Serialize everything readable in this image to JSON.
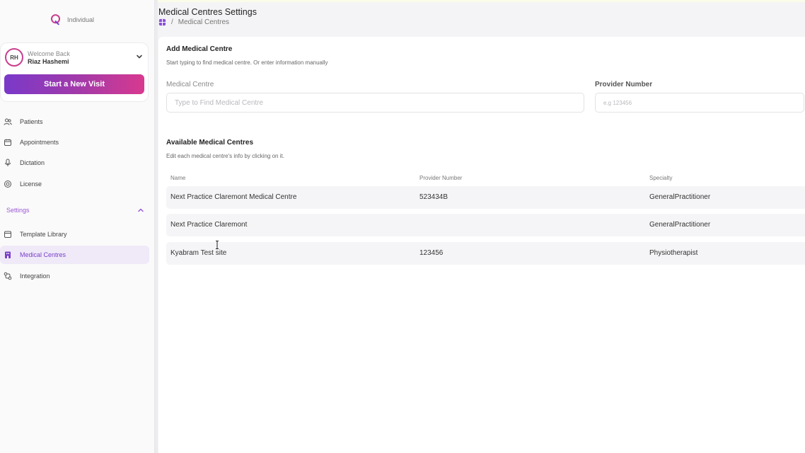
{
  "brand": {
    "name": "Individual",
    "accent": "#c93f8f"
  },
  "user": {
    "initials": "RH",
    "welcome": "Welcome Back",
    "name": "Riaz Hashemi"
  },
  "start_visit_label": "Start a New Visit",
  "nav": {
    "items": [
      {
        "label": "Patients",
        "icon": "users-icon"
      },
      {
        "label": "Appointments",
        "icon": "calendar-icon"
      },
      {
        "label": "Dictation",
        "icon": "microphone-icon"
      },
      {
        "label": "License",
        "icon": "license-icon"
      }
    ],
    "settings_label": "Settings",
    "settings_items": [
      {
        "label": "Template Library",
        "icon": "template-icon"
      },
      {
        "label": "Medical Centres",
        "icon": "building-icon",
        "active": true
      },
      {
        "label": "Integration",
        "icon": "integration-icon"
      }
    ]
  },
  "header": {
    "title": "Medical Centres Settings",
    "breadcrumb_sep": "/",
    "breadcrumb_current": "Medical Centres"
  },
  "add_section": {
    "title": "Add Medical Centre",
    "subtitle": "Start typing to find medical centre. Or enter information manually",
    "centre_label": "Medical Centre",
    "centre_placeholder": "Type to Find Medical Centre",
    "provider_label": "Provider Number",
    "provider_placeholder": "e.g 123456"
  },
  "available_section": {
    "title": "Available Medical Centres",
    "subtitle": "Edit each medical centre's info by clicking on it.",
    "columns": [
      "Name",
      "Provider Number",
      "Specialty"
    ],
    "rows": [
      {
        "name": "Next Practice Claremont Medical Centre",
        "provider": "523434B",
        "specialty": "GeneralPractitioner"
      },
      {
        "name": "Next Practice Claremont",
        "provider": "",
        "specialty": "GeneralPractitioner"
      },
      {
        "name": "Kyabram Test site",
        "provider": "123456",
        "specialty": "Physiotherapist"
      }
    ]
  },
  "colors": {
    "primary": "#7a3fc8",
    "gradient_end": "#d8398f",
    "active_bg": "#efe9f8"
  }
}
